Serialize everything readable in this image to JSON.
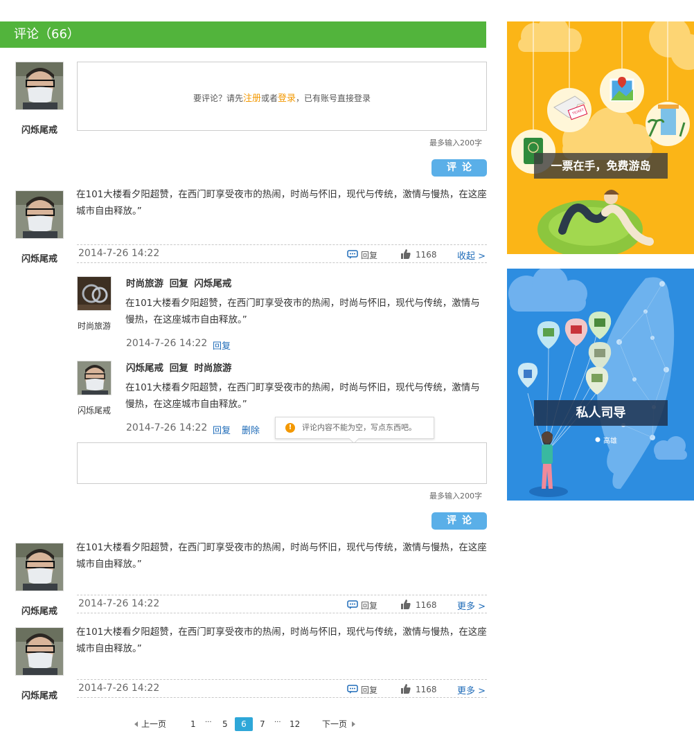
{
  "header": {
    "title": "评论（66）"
  },
  "composer": {
    "username": "闪烁尾戒",
    "prompt_prefix": "要评论？请先",
    "register_link": "注册",
    "or_text": "或者",
    "login_link": "登录",
    "prompt_suffix": "，已有账号直接登录",
    "maxchars": "最多输入200字",
    "submit_label": "评论"
  },
  "comments": [
    {
      "username": "闪烁尾戒",
      "text": "在101大楼看夕阳超赞，在西门町享受夜市的热闹，时尚与怀旧，现代与传统，激情与慢热，在这座城市自由释放。”",
      "date": "2014-7-26 14:22",
      "reply_label": "回复",
      "likes": "1168",
      "toggle_label": "收起 >"
    },
    {
      "username": "闪烁尾戒",
      "text": "在101大楼看夕阳超赞，在西门町享受夜市的热闹，时尚与怀旧，现代与传统，激情与慢热，在这座城市自由释放。”",
      "date": "2014-7-26 14:22",
      "reply_label": "回复",
      "likes": "1168",
      "toggle_label": "更多 >"
    },
    {
      "username": "闪烁尾戒",
      "text": "在101大楼看夕阳超赞，在西门町享受夜市的热闹，时尚与怀旧，现代与传统，激情与慢热，在这座城市自由释放。”",
      "date": "2014-7-26 14:22",
      "reply_label": "回复",
      "likes": "1168",
      "toggle_label": "更多 >"
    }
  ],
  "replies": [
    {
      "username": "时尚旅游",
      "from": "时尚旅游",
      "verb": "回复",
      "to": "闪烁尾戒",
      "text": "在101大楼看夕阳超赞，在西门町享受夜市的热闹，时尚与怀旧，现代与传统，激情与慢热，在这座城市自由释放。”",
      "date": "2014-7-26 14:22",
      "reply_label": "回复"
    },
    {
      "username": "闪烁尾戒",
      "from": "闪烁尾戒",
      "verb": "回复",
      "to": "时尚旅游",
      "text": "在101大楼看夕阳超赞，在西门町享受夜市的热闹，时尚与怀旧，现代与传统，激情与慢热，在这座城市自由释放。”",
      "date": "2014-7-26 14:22",
      "reply_label": "回复",
      "delete_label": "删除"
    }
  ],
  "tooltip": {
    "icon": "!",
    "text": "评论内容不能为空，写点东西吧。"
  },
  "reply_box": {
    "maxchars": "最多输入200字",
    "submit_label": "评论"
  },
  "pagination": {
    "prev": "上一页",
    "next": "下一页",
    "ellipsis": "···",
    "pages": [
      "1",
      "5",
      "6",
      "7",
      "12"
    ],
    "current": "6"
  },
  "ads": {
    "ticket": {
      "label": "一票在手，免费游岛",
      "badge": "TICKET"
    },
    "guide": {
      "label": "私人司导",
      "city": "高雄"
    }
  },
  "colors": {
    "accent_green": "#52b43c",
    "button_blue": "#5aafe8",
    "link_orange": "#f39800",
    "link_blue": "#1e6bb8"
  }
}
